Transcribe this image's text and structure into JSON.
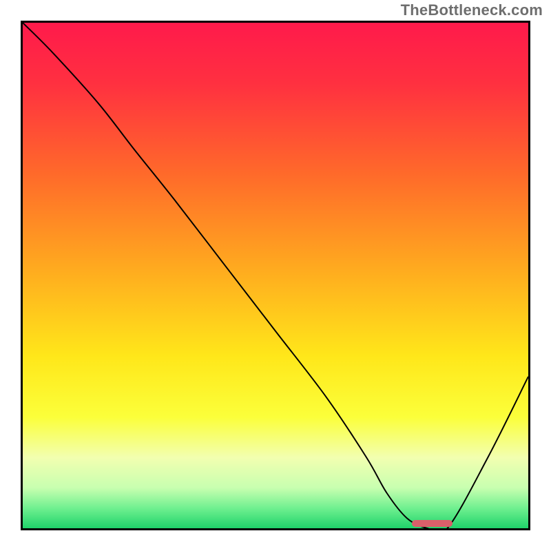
{
  "watermark": "TheBottleneck.com",
  "colors": {
    "gradient_stops": [
      {
        "pos": 0,
        "color": "#ff1a4b"
      },
      {
        "pos": 12,
        "color": "#ff3040"
      },
      {
        "pos": 30,
        "color": "#ff6a2a"
      },
      {
        "pos": 48,
        "color": "#ffa81f"
      },
      {
        "pos": 66,
        "color": "#ffe71a"
      },
      {
        "pos": 78,
        "color": "#fbff3a"
      },
      {
        "pos": 86,
        "color": "#f2ffb0"
      },
      {
        "pos": 92,
        "color": "#c8ffb0"
      },
      {
        "pos": 96,
        "color": "#70f090"
      },
      {
        "pos": 100,
        "color": "#1fd36a"
      }
    ],
    "marker": "#d9606a",
    "curve": "#000000"
  },
  "chart_data": {
    "type": "line",
    "title": "",
    "xlabel": "",
    "ylabel": "",
    "xlim": [
      0,
      100
    ],
    "ylim": [
      0,
      100
    ],
    "series": [
      {
        "name": "bottleneck-curve",
        "x": [
          0,
          6,
          15,
          22,
          30,
          40,
          50,
          60,
          68,
          72,
          76,
          80,
          84,
          92,
          100
        ],
        "y": [
          100,
          94,
          84,
          75,
          65,
          52,
          39,
          26,
          14,
          7,
          2,
          0,
          0,
          14,
          30
        ]
      }
    ],
    "optimum_marker": {
      "x_start": 77,
      "x_end": 85,
      "y": 0
    }
  }
}
